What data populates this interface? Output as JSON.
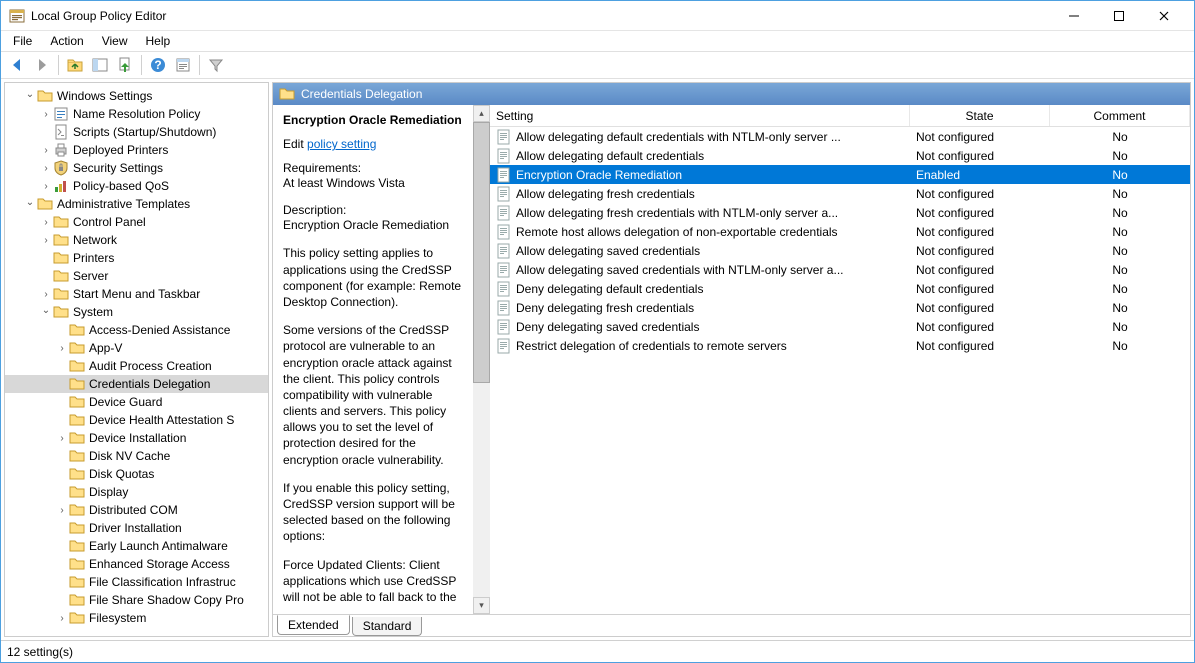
{
  "window": {
    "title": "Local Group Policy Editor"
  },
  "menubar": [
    "File",
    "Action",
    "View",
    "Help"
  ],
  "tree": [
    {
      "indent": 0,
      "exp": "v",
      "icon": "folder",
      "label": "Windows Settings"
    },
    {
      "indent": 1,
      "exp": ">",
      "icon": "policy",
      "label": "Name Resolution Policy"
    },
    {
      "indent": 1,
      "exp": "",
      "icon": "script",
      "label": "Scripts (Startup/Shutdown)"
    },
    {
      "indent": 1,
      "exp": ">",
      "icon": "printer",
      "label": "Deployed Printers"
    },
    {
      "indent": 1,
      "exp": ">",
      "icon": "security",
      "label": "Security Settings"
    },
    {
      "indent": 1,
      "exp": ">",
      "icon": "qos",
      "label": "Policy-based QoS"
    },
    {
      "indent": 0,
      "exp": "v",
      "icon": "folder",
      "label": "Administrative Templates"
    },
    {
      "indent": 1,
      "exp": ">",
      "icon": "folder",
      "label": "Control Panel"
    },
    {
      "indent": 1,
      "exp": ">",
      "icon": "folder",
      "label": "Network"
    },
    {
      "indent": 1,
      "exp": "",
      "icon": "folder",
      "label": "Printers"
    },
    {
      "indent": 1,
      "exp": "",
      "icon": "folder",
      "label": "Server"
    },
    {
      "indent": 1,
      "exp": ">",
      "icon": "folder",
      "label": "Start Menu and Taskbar"
    },
    {
      "indent": 1,
      "exp": "v",
      "icon": "folder",
      "label": "System"
    },
    {
      "indent": 2,
      "exp": "",
      "icon": "folder",
      "label": "Access-Denied Assistance"
    },
    {
      "indent": 2,
      "exp": ">",
      "icon": "folder",
      "label": "App-V"
    },
    {
      "indent": 2,
      "exp": "",
      "icon": "folder",
      "label": "Audit Process Creation"
    },
    {
      "indent": 2,
      "exp": "",
      "icon": "folder",
      "label": "Credentials Delegation",
      "selected": true
    },
    {
      "indent": 2,
      "exp": "",
      "icon": "folder",
      "label": "Device Guard"
    },
    {
      "indent": 2,
      "exp": "",
      "icon": "folder",
      "label": "Device Health Attestation S"
    },
    {
      "indent": 2,
      "exp": ">",
      "icon": "folder",
      "label": "Device Installation"
    },
    {
      "indent": 2,
      "exp": "",
      "icon": "folder",
      "label": "Disk NV Cache"
    },
    {
      "indent": 2,
      "exp": "",
      "icon": "folder",
      "label": "Disk Quotas"
    },
    {
      "indent": 2,
      "exp": "",
      "icon": "folder",
      "label": "Display"
    },
    {
      "indent": 2,
      "exp": ">",
      "icon": "folder",
      "label": "Distributed COM"
    },
    {
      "indent": 2,
      "exp": "",
      "icon": "folder",
      "label": "Driver Installation"
    },
    {
      "indent": 2,
      "exp": "",
      "icon": "folder",
      "label": "Early Launch Antimalware"
    },
    {
      "indent": 2,
      "exp": "",
      "icon": "folder",
      "label": "Enhanced Storage Access"
    },
    {
      "indent": 2,
      "exp": "",
      "icon": "folder",
      "label": "File Classification Infrastruc"
    },
    {
      "indent": 2,
      "exp": "",
      "icon": "folder",
      "label": "File Share Shadow Copy Pro"
    },
    {
      "indent": 2,
      "exp": ">",
      "icon": "folder",
      "label": "Filesystem"
    }
  ],
  "right": {
    "header": "Credentials Delegation",
    "desc": {
      "title": "Encryption Oracle Remediation",
      "edit_prefix": "Edit ",
      "edit_link": "policy setting",
      "req_label": "Requirements:",
      "req_value": "At least Windows Vista",
      "desc_label": "Description:",
      "desc_value": "Encryption Oracle Remediation",
      "p1": "This policy setting applies to applications using the CredSSP component (for example: Remote Desktop Connection).",
      "p2": "Some versions of the CredSSP protocol are vulnerable to an encryption oracle attack against the client.  This policy controls compatibility with vulnerable clients and servers.  This policy allows you to set the level of protection desired for the encryption oracle vulnerability.",
      "p3": "If you enable this policy setting, CredSSP version support will be selected based on the following options:",
      "p4": "Force Updated Clients: Client applications which use CredSSP will not be able to fall back to the"
    },
    "columns": {
      "setting": "Setting",
      "state": "State",
      "comment": "Comment"
    },
    "rows": [
      {
        "setting": "Allow delegating default credentials with NTLM-only server ...",
        "state": "Not configured",
        "comment": "No"
      },
      {
        "setting": "Allow delegating default credentials",
        "state": "Not configured",
        "comment": "No"
      },
      {
        "setting": "Encryption Oracle Remediation",
        "state": "Enabled",
        "comment": "No",
        "selected": true
      },
      {
        "setting": "Allow delegating fresh credentials",
        "state": "Not configured",
        "comment": "No"
      },
      {
        "setting": "Allow delegating fresh credentials with NTLM-only server a...",
        "state": "Not configured",
        "comment": "No"
      },
      {
        "setting": "Remote host allows delegation of non-exportable credentials",
        "state": "Not configured",
        "comment": "No"
      },
      {
        "setting": "Allow delegating saved credentials",
        "state": "Not configured",
        "comment": "No"
      },
      {
        "setting": "Allow delegating saved credentials with NTLM-only server a...",
        "state": "Not configured",
        "comment": "No"
      },
      {
        "setting": "Deny delegating default credentials",
        "state": "Not configured",
        "comment": "No"
      },
      {
        "setting": "Deny delegating fresh credentials",
        "state": "Not configured",
        "comment": "No"
      },
      {
        "setting": "Deny delegating saved credentials",
        "state": "Not configured",
        "comment": "No"
      },
      {
        "setting": "Restrict delegation of credentials to remote servers",
        "state": "Not configured",
        "comment": "No"
      }
    ],
    "tabs": {
      "extended": "Extended",
      "standard": "Standard"
    }
  },
  "status": "12 setting(s)"
}
